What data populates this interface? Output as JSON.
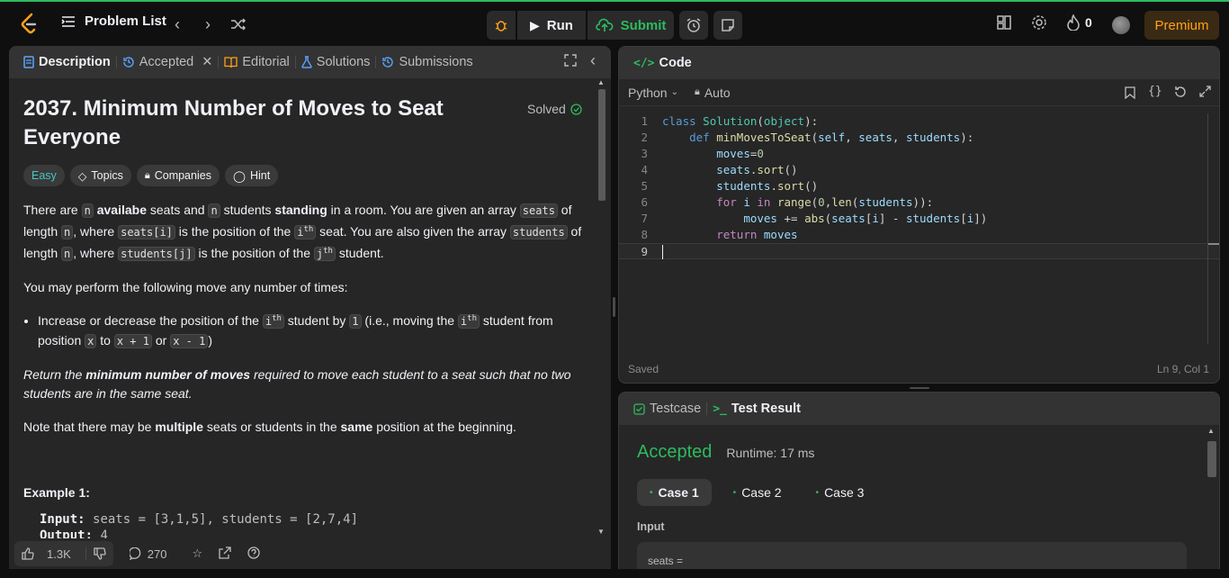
{
  "topbar": {
    "problem_list": "Problem List",
    "run": "Run",
    "submit": "Submit",
    "streak": "0",
    "premium": "Premium",
    "colors": {
      "accent": "#2cbb5d",
      "premium": "#ffa116"
    }
  },
  "description": {
    "tabs": [
      "Description",
      "Accepted",
      "Editorial",
      "Solutions",
      "Submissions"
    ],
    "title": "2037. Minimum Number of Moves to Seat Everyone",
    "solved": "Solved",
    "chips": [
      "Easy",
      "Topics",
      "Companies",
      "Hint"
    ],
    "p1": {
      "a": "There are ",
      "n": "n",
      "b": " ",
      "availabe": "availabe",
      "c": " seats and ",
      "d": " students ",
      "standing": "standing",
      "e": " in a room. You are given an array ",
      "seats": "seats",
      "f": " of length ",
      "g": ", where ",
      "seats_i": "seats[i]",
      "h": " is the position of the ",
      "ith": "i",
      "th": "th",
      "i": " seat. You are also given the array ",
      "students": "students",
      "j": " of length ",
      "k": ", where ",
      "students_j": "students[j]",
      "l": " is the position of the ",
      "jth": "j",
      "m": " student."
    },
    "p2": "You may perform the following move any number of times:",
    "bullet": {
      "a": "Increase or decrease the position of the ",
      "b": " student by ",
      "one": "1",
      "c": " (i.e., moving the ",
      "d": " student from position ",
      "x": "x",
      "e": " to ",
      "xp1": "x + 1",
      "f": " or ",
      "xm1": "x - 1",
      "g": ")"
    },
    "p3": {
      "a": "Return the ",
      "b": "minimum number of moves",
      "c": " required to move each student to a seat such that no two students are in the same seat."
    },
    "p4": {
      "a": "Note that there may be ",
      "b": "multiple",
      "c": " seats or students in the ",
      "d": "same",
      "e": " position at the beginning."
    },
    "example_title": "Example 1:",
    "example_input_label": "Input:",
    "example_input": "seats = [3,1,5], students = [2,7,4]",
    "example_output_label": "Output:",
    "example_output": "4",
    "footer": {
      "likes": "1.3K",
      "comments": "270"
    }
  },
  "code": {
    "header": "Code",
    "language": "Python",
    "mode": "Auto",
    "status": "Saved",
    "cursor": "Ln 9, Col 1",
    "lines": [
      "class Solution(object):",
      "    def minMovesToSeat(self, seats, students):",
      "        moves=0",
      "        seats.sort()",
      "        students.sort()",
      "        for i in range(0,len(students)):",
      "            moves += abs(seats[i] - students[i])",
      "        return moves",
      ""
    ],
    "line_numbers": [
      "1",
      "2",
      "3",
      "4",
      "5",
      "6",
      "7",
      "8",
      "9"
    ]
  },
  "result": {
    "tabs": [
      "Testcase",
      "Test Result"
    ],
    "status": "Accepted",
    "runtime": "Runtime: 17 ms",
    "cases": [
      "Case 1",
      "Case 2",
      "Case 3"
    ],
    "input_label": "Input",
    "input_preview": "seats ="
  }
}
